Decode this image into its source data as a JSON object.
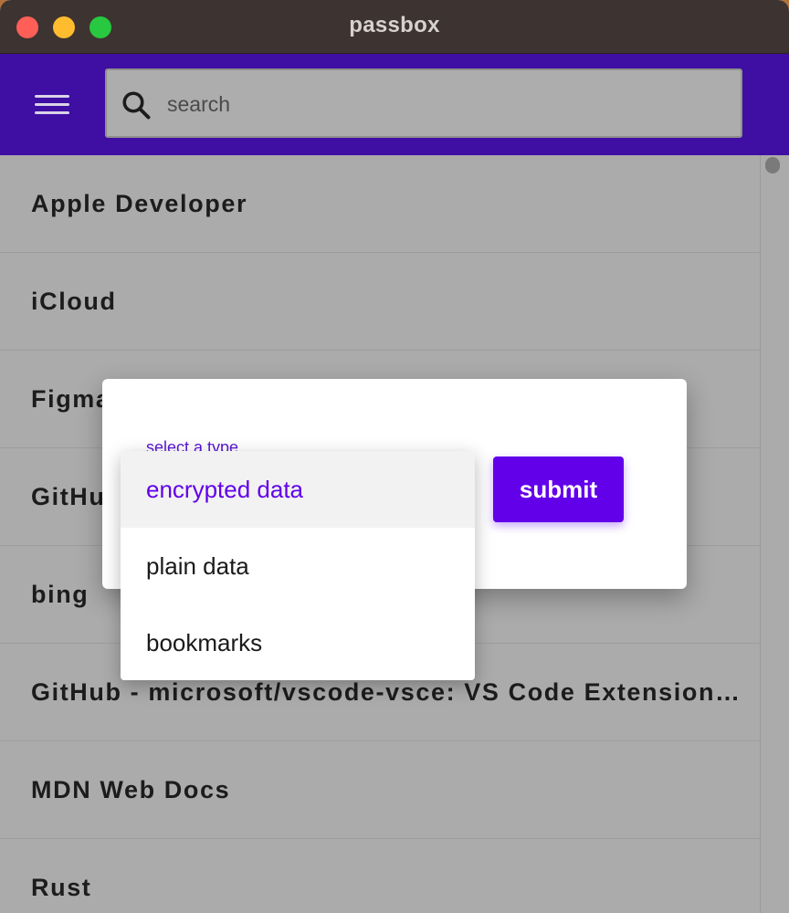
{
  "window": {
    "title": "passbox"
  },
  "search": {
    "placeholder": "search",
    "icon": "search-icon"
  },
  "colors": {
    "appbar": "#3f0ea3",
    "accent": "#6200ea"
  },
  "list": {
    "items": [
      "Apple Developer",
      "iCloud",
      "Figma",
      "GitHub",
      "bing",
      "GitHub - microsoft/vscode-vsce: VS Code Extension…",
      "MDN Web Docs",
      "Rust"
    ]
  },
  "dialog": {
    "select_label": "select a type",
    "submit_label": "submit",
    "options": [
      "encrypted data",
      "plain data",
      "bookmarks"
    ],
    "selected_option": "encrypted data"
  }
}
